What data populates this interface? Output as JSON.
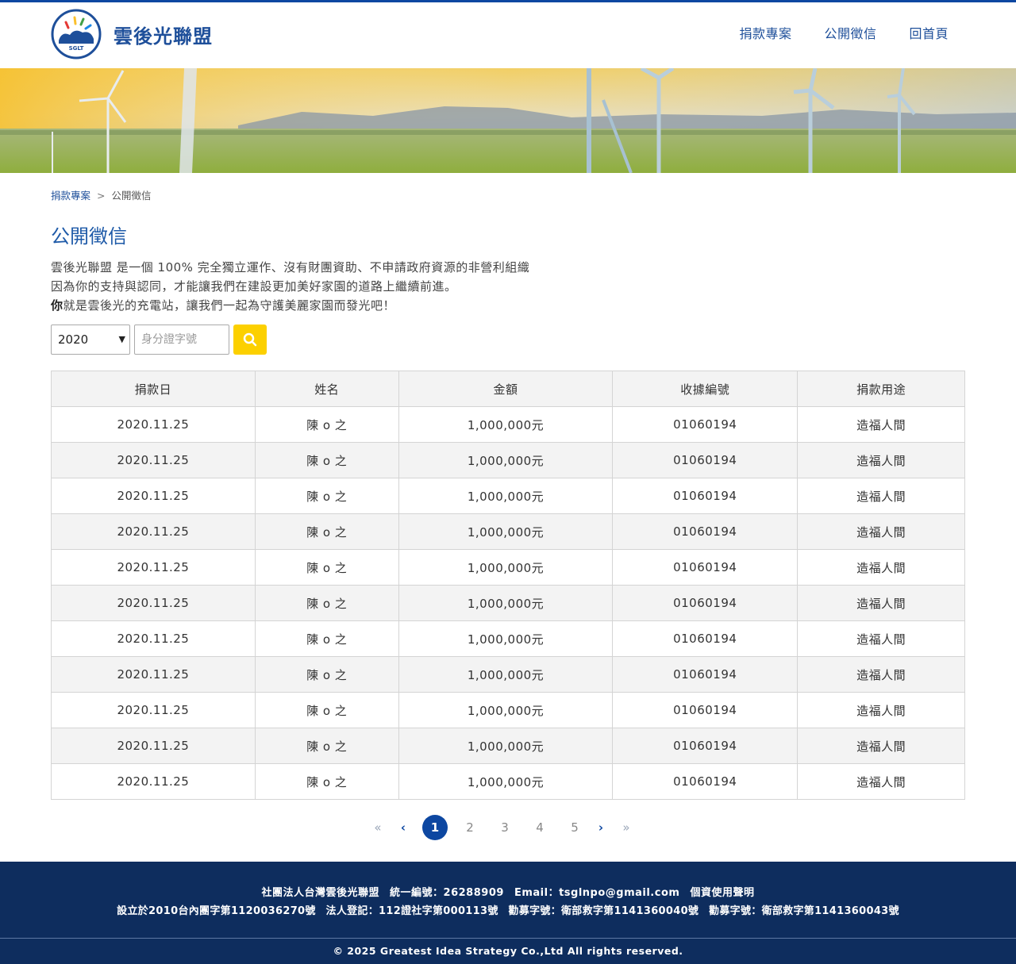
{
  "header": {
    "brand": "雲後光聯盟",
    "logo_text": "SGLT",
    "nav": [
      "捐款專案",
      "公開徵信",
      "回首頁"
    ]
  },
  "breadcrumb": {
    "parent": "捐款專案",
    "separator": ">",
    "current": "公開徵信"
  },
  "page_title": "公開徵信",
  "intro": {
    "line1": "雲後光聯盟 是一個 100% 完全獨立運作、沒有財團資助、不申請政府資源的非營利組織",
    "line2": "因為你的支持與認同，才能讓我們在建設更加美好家園的道路上繼續前進。",
    "line3_bold": "你",
    "line3_rest": "就是雲後光的充電站，讓我們一起為守護美麗家園而發光吧！"
  },
  "filters": {
    "year": "2020",
    "id_placeholder": "身分證字號"
  },
  "table": {
    "headers": [
      "捐款日",
      "姓名",
      "金額",
      "收據編號",
      "捐款用途"
    ],
    "rows": [
      [
        "2020.11.25",
        "陳 o 之",
        "1,000,000元",
        "01060194",
        "造福人間"
      ],
      [
        "2020.11.25",
        "陳 o 之",
        "1,000,000元",
        "01060194",
        "造福人間"
      ],
      [
        "2020.11.25",
        "陳 o 之",
        "1,000,000元",
        "01060194",
        "造福人間"
      ],
      [
        "2020.11.25",
        "陳 o 之",
        "1,000,000元",
        "01060194",
        "造福人間"
      ],
      [
        "2020.11.25",
        "陳 o 之",
        "1,000,000元",
        "01060194",
        "造福人間"
      ],
      [
        "2020.11.25",
        "陳 o 之",
        "1,000,000元",
        "01060194",
        "造福人間"
      ],
      [
        "2020.11.25",
        "陳 o 之",
        "1,000,000元",
        "01060194",
        "造福人間"
      ],
      [
        "2020.11.25",
        "陳 o 之",
        "1,000,000元",
        "01060194",
        "造福人間"
      ],
      [
        "2020.11.25",
        "陳 o 之",
        "1,000,000元",
        "01060194",
        "造福人間"
      ],
      [
        "2020.11.25",
        "陳 o 之",
        "1,000,000元",
        "01060194",
        "造福人間"
      ],
      [
        "2020.11.25",
        "陳 o 之",
        "1,000,000元",
        "01060194",
        "造福人間"
      ]
    ]
  },
  "pagination": {
    "first": "«",
    "prev": "‹",
    "next": "›",
    "last": "»",
    "pages": [
      "1",
      "2",
      "3",
      "4",
      "5"
    ],
    "active": "1"
  },
  "footer": {
    "org": "社團法人台灣雲後光聯盟",
    "tax_id": "統一編號：26288909",
    "email": "Email：tsglnpo@gmail.com",
    "privacy": "個資使用聲明",
    "established": "設立於2010台內團字第1120036270號",
    "registration": "法人登記：112證社字第000113號",
    "fundraising1": "勸募字號：衛部救字第1141360040號",
    "fundraising2": "勸募字號：衛部救字第1141360043號",
    "copyright": "© 2025 Greatest Idea Strategy Co.,Ltd All rights reserved."
  },
  "colors": {
    "primary": "#0d47a1",
    "brand_text": "#1e4f9a",
    "search_button": "#fcd000",
    "footer_bg": "#0e2d5e"
  },
  "icons": [
    "logo-icon",
    "search-icon",
    "chevron-down-icon",
    "double-chevron-left-icon",
    "chevron-left-icon",
    "chevron-right-icon",
    "double-chevron-right-icon"
  ]
}
